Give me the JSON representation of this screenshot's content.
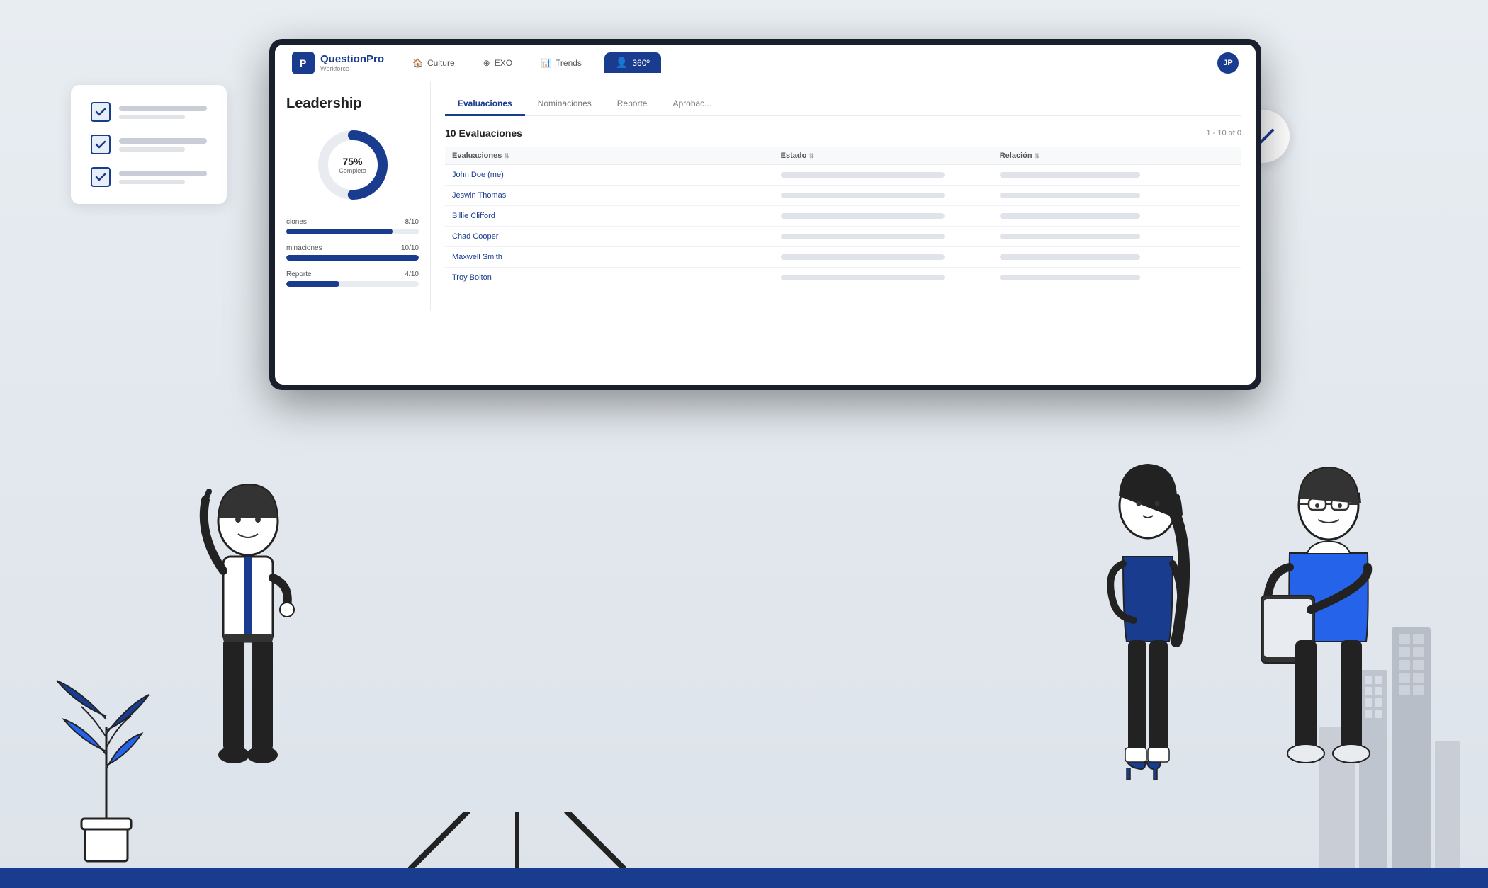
{
  "app": {
    "logo": {
      "icon": "P",
      "main": "QuestionPro",
      "sub": "Workforce"
    },
    "nav": {
      "items": [
        {
          "label": "Culture",
          "icon": "🏠",
          "active": false
        },
        {
          "label": "EXO",
          "icon": "⊕",
          "active": false
        },
        {
          "label": "Trends",
          "icon": "📊",
          "active": false
        },
        {
          "label": "360º",
          "icon": "👤",
          "active": true
        }
      ],
      "user_initials": "JP"
    }
  },
  "left_panel": {
    "title": "Leadership",
    "donut": {
      "percent": "75%",
      "label": "Completo"
    },
    "stats": [
      {
        "label": "ciones",
        "value": "8/10",
        "fill_pct": 80
      },
      {
        "label": "minaciones",
        "value": "10/10",
        "fill_pct": 100
      },
      {
        "label": "Reporte",
        "value": "4/10",
        "fill_pct": 40
      }
    ]
  },
  "right_panel": {
    "tabs": [
      {
        "label": "Evaluaciones",
        "active": true
      },
      {
        "label": "Nominaciones",
        "active": false
      },
      {
        "label": "Reporte",
        "active": false
      },
      {
        "label": "Aprobac...",
        "active": false
      }
    ],
    "count_label": "10 Evaluaciones",
    "pagination": "1 - 10 of 0",
    "table": {
      "headers": [
        {
          "label": "Evaluaciones",
          "sortable": true
        },
        {
          "label": "Estado",
          "sortable": true
        },
        {
          "label": "Relación",
          "sortable": true
        }
      ],
      "rows": [
        {
          "name": "John Doe (me)",
          "is_link": true
        },
        {
          "name": "Jeswin Thomas",
          "is_link": true
        },
        {
          "name": "Billie Clifford",
          "is_link": true
        },
        {
          "name": "Chad Cooper",
          "is_link": true
        },
        {
          "name": "Maxwell Smith",
          "is_link": true
        },
        {
          "name": "Troy Bolton",
          "is_link": true
        }
      ]
    }
  },
  "checklist_card": {
    "items": [
      {
        "checked": true
      },
      {
        "checked": true
      },
      {
        "checked": true
      }
    ]
  },
  "check_bubble": {
    "checked": true
  },
  "colors": {
    "primary": "#1a3c8f",
    "accent": "#2563eb",
    "light_gray": "#e8ecf0",
    "text_dark": "#222222",
    "text_gray": "#666666"
  }
}
